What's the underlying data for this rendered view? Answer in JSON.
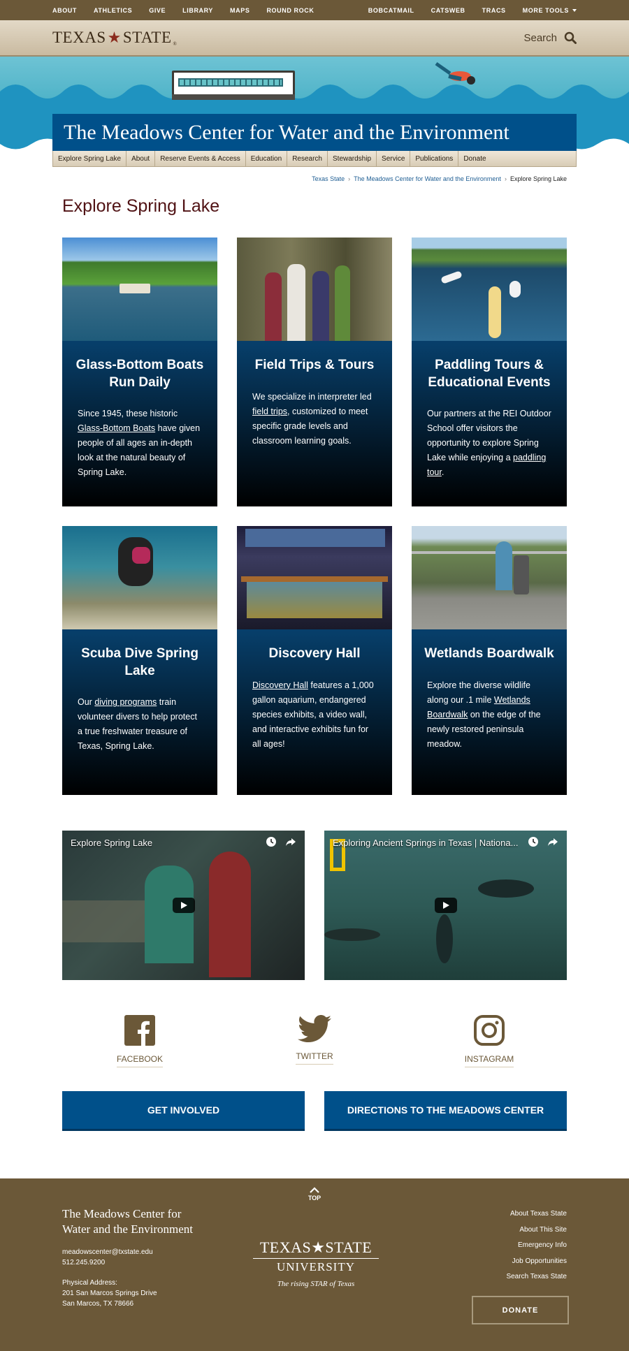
{
  "topbar": {
    "left": [
      "ABOUT",
      "ATHLETICS",
      "GIVE",
      "LIBRARY",
      "MAPS",
      "ROUND ROCK"
    ],
    "right": [
      "BOBCATMAIL",
      "CATSWEB",
      "TRACS",
      "MORE TOOLS"
    ]
  },
  "header": {
    "logo_left": "TEXAS",
    "logo_star": "★",
    "logo_right": "STATE",
    "logo_reg": "®",
    "search_label": "Search"
  },
  "hero": {
    "title": "The Meadows Center for Water and the Environment"
  },
  "subnav": [
    "Explore Spring Lake",
    "About",
    "Reserve Events & Access",
    "Education",
    "Research",
    "Stewardship",
    "Service",
    "Publications",
    "Donate"
  ],
  "breadcrumb": {
    "home": "Texas State",
    "section": "The Meadows Center for Water and the Environment",
    "current": "Explore Spring Lake",
    "sep": "›"
  },
  "page_title": "Explore Spring Lake",
  "cards": [
    {
      "title": "Glass-Bottom Boats Run Daily",
      "pre": "Since 1945, these historic ",
      "link": "Glass-Bottom Boats",
      "post": " have given people of all ages an in-depth look at the natural beauty of Spring Lake."
    },
    {
      "title": "Field Trips & Tours",
      "pre": "We specialize in interpreter led ",
      "link": "field trips",
      "post": ", customized to meet specific grade levels and classroom learning goals."
    },
    {
      "title": "Paddling Tours & Educational Events",
      "pre": "Our partners at the REI Outdoor School offer visitors the opportunity to explore Spring Lake while enjoying a ",
      "link": "paddling tour",
      "post": "."
    },
    {
      "title": "Scuba Dive Spring Lake",
      "pre": "Our ",
      "link": "diving programs",
      "post": " train volunteer divers to help protect a true freshwater treasure of Texas, Spring Lake."
    },
    {
      "title": "Discovery Hall",
      "pre": "",
      "link": "Discovery Hall",
      "post": " features a 1,000 gallon aquarium, endangered species exhibits, a video wall, and interactive exhibits fun for all ages!"
    },
    {
      "title": "Wetlands Boardwalk",
      "pre": "Explore the diverse wildlife along our .1 mile ",
      "link": "Wetlands Boardwalk",
      "post": " on the edge of the newly restored peninsula meadow."
    }
  ],
  "videos": [
    {
      "title": "Explore Spring Lake"
    },
    {
      "title": "Exploring Ancient Springs in Texas | Nationa..."
    }
  ],
  "social": [
    {
      "label": "FACEBOOK",
      "icon": "facebook-icon"
    },
    {
      "label": "TWITTER",
      "icon": "twitter-icon"
    },
    {
      "label": "INSTAGRAM",
      "icon": "instagram-icon"
    }
  ],
  "ctas": [
    "GET INVOLVED",
    "DIRECTIONS TO THE MEADOWS CENTER"
  ],
  "footer": {
    "top_label": "TOP",
    "title_line1": "The Meadows Center for",
    "title_line2": "Water and the Environment",
    "email": "meadowscenter@txstate.edu",
    "phone": "512.245.9200",
    "address_label": "Physical Address:",
    "address1": "201 San Marcos Springs Drive",
    "address2": "San Marcos, TX 78666",
    "logo_line1": "TEXAS★STATE",
    "logo_line2": "UNIVERSITY",
    "tagline": "The rising STAR of Texas",
    "links": [
      "About Texas State",
      "About This Site",
      "Emergency Info",
      "Job Opportunities",
      "Search Texas State"
    ],
    "donate": "DONATE"
  },
  "colors": {
    "brand_maroon": "#501214",
    "brand_gold": "#6b5838",
    "accent_blue": "#00508a"
  }
}
